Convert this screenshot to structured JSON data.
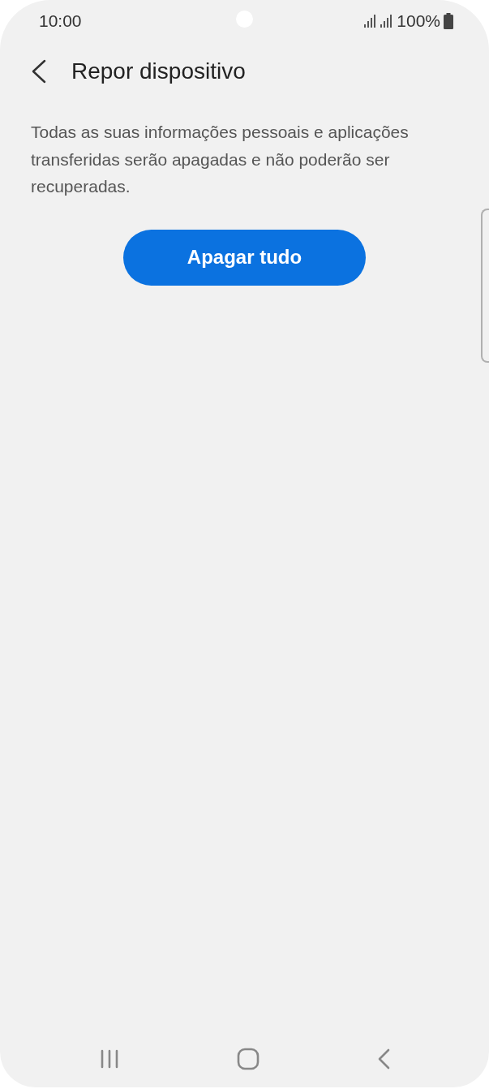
{
  "status_bar": {
    "time": "10:00",
    "battery": "100%"
  },
  "header": {
    "title": "Repor dispositivo"
  },
  "description": "Todas as suas informações pessoais e aplicações transferidas serão apagadas e não poderão ser recuperadas.",
  "action_button": {
    "label": "Apagar tudo"
  }
}
